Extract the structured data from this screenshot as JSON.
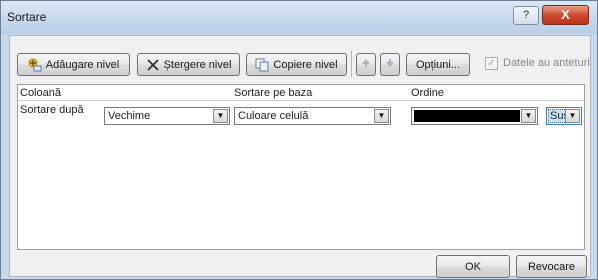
{
  "window": {
    "title": "Sortare",
    "help": "?",
    "close": "X"
  },
  "toolbar": {
    "add_level": "Adăugare nivel",
    "delete_level": "Ștergere nivel",
    "copy_level": "Copiere nivel",
    "options": "Opțiuni...",
    "headers_checkbox_label": "Datele au anteturi"
  },
  "grid": {
    "headers": {
      "column": "Coloană",
      "sort_on": "Sortare pe baza",
      "order": "Ordine"
    },
    "rows": [
      {
        "label": "Sortare după",
        "column": "Vechime",
        "sort_on": "Culoare celulă",
        "order_color": "#000000",
        "order_position": "Sus"
      }
    ]
  },
  "footer": {
    "ok": "OK",
    "cancel": "Revocare"
  }
}
